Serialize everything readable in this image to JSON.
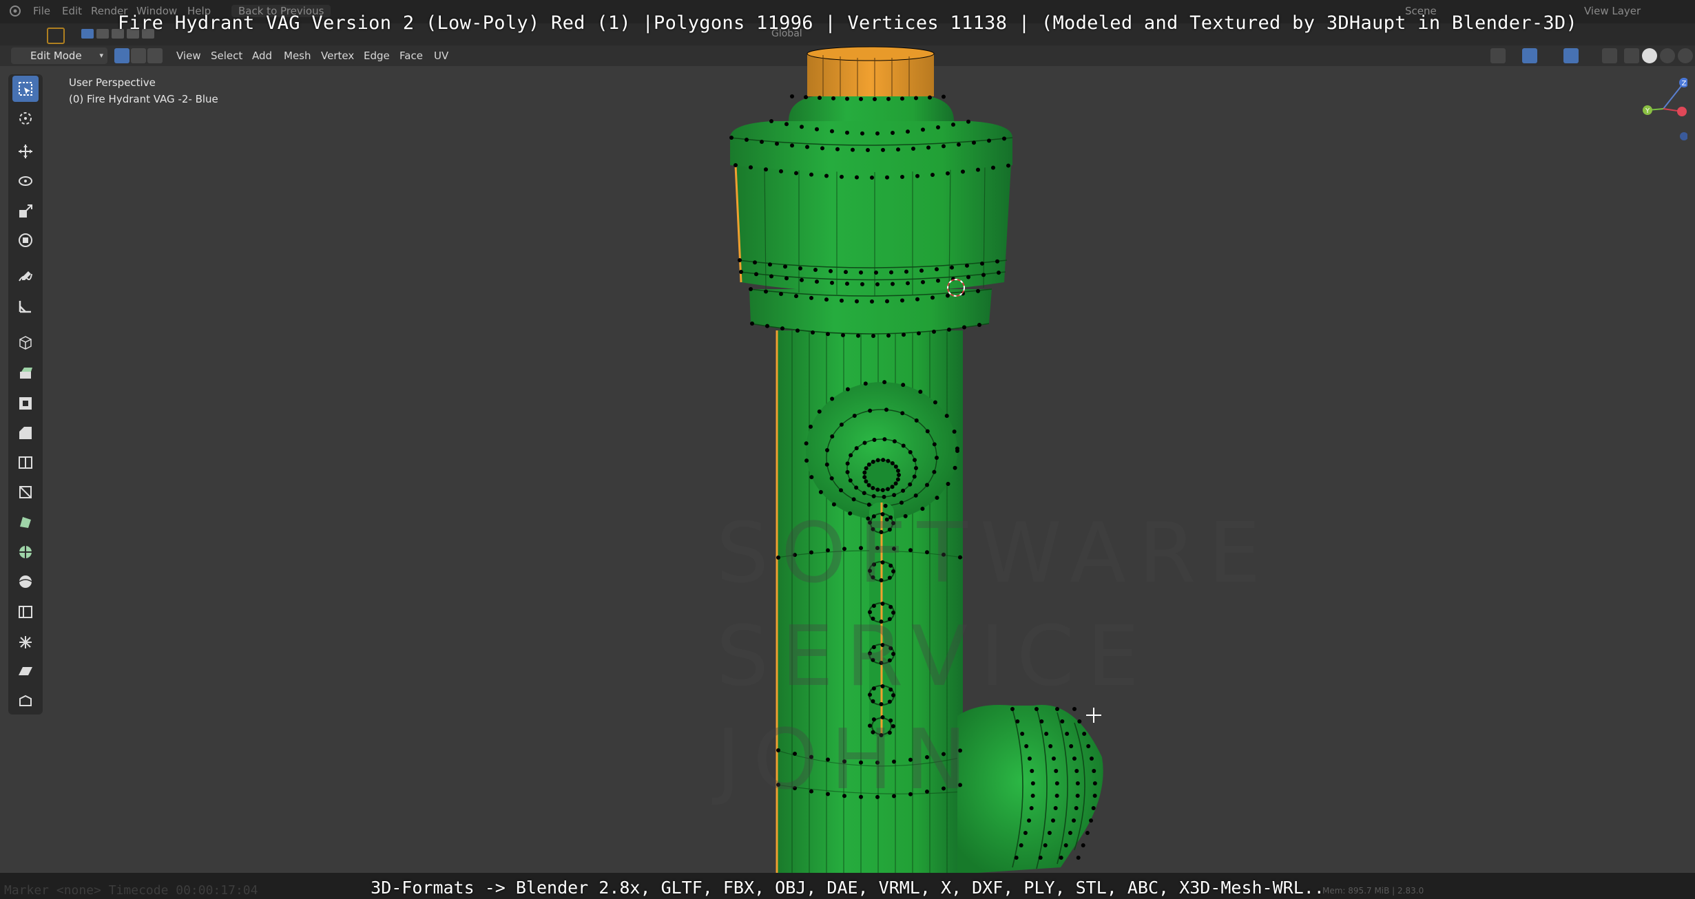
{
  "overlay": {
    "title": "Fire Hydrant VAG Version 2 (Low-Poly) Red (1) |Polygons 11996 | Vertices 11138 | (Modeled and Textured by 3DHaupt in Blender-3D)",
    "footer": "3D-Formats -> Blender 2.8x, GLTF, FBX, OBJ, DAE, VRML, X, DXF, PLY, STL, ABC, X3D-Mesh-WRL.."
  },
  "menubar": {
    "items": [
      "File",
      "Edit",
      "Render",
      "Window",
      "Help"
    ],
    "back_button": "Back to Previous",
    "scene_label": "Scene",
    "view_layer_label": "View Layer"
  },
  "header": {
    "mode": "Edit Mode",
    "menus": [
      "View",
      "Select",
      "Add",
      "Mesh",
      "Vertex",
      "Edge",
      "Face",
      "UV"
    ],
    "transform_orientation": "Global"
  },
  "viewport": {
    "perspective_label": "User Perspective",
    "object_label": "(0) Fire Hydrant VAG -2- Blue",
    "watermark_lines": [
      "SOFTWARE",
      "SERVICE",
      "JOHN"
    ]
  },
  "toolbar": {
    "tools": [
      "select-box",
      "cursor",
      "move",
      "rotate",
      "scale",
      "transform",
      "annotate",
      "measure",
      "add-cube",
      "extrude",
      "inset",
      "bevel",
      "loop-cut",
      "knife",
      "poly-build",
      "spin",
      "smooth",
      "edge-slide",
      "shrink-fatten",
      "shear",
      "rip-region"
    ]
  },
  "gizmo": {
    "axes": [
      "Z",
      "Y",
      "X"
    ]
  },
  "statusbar": {
    "timecode": "Marker <none>   Timecode 00:00:17:04",
    "info": "Mem: 895.7 MiB | 2.83.0"
  },
  "colors": {
    "viewport_bg": "#3b3b3b",
    "mesh_green": "#23a33a",
    "mesh_green_dark": "#1b7d2c",
    "selection_orange": "#f0a030",
    "active_blue": "#4772b3"
  }
}
